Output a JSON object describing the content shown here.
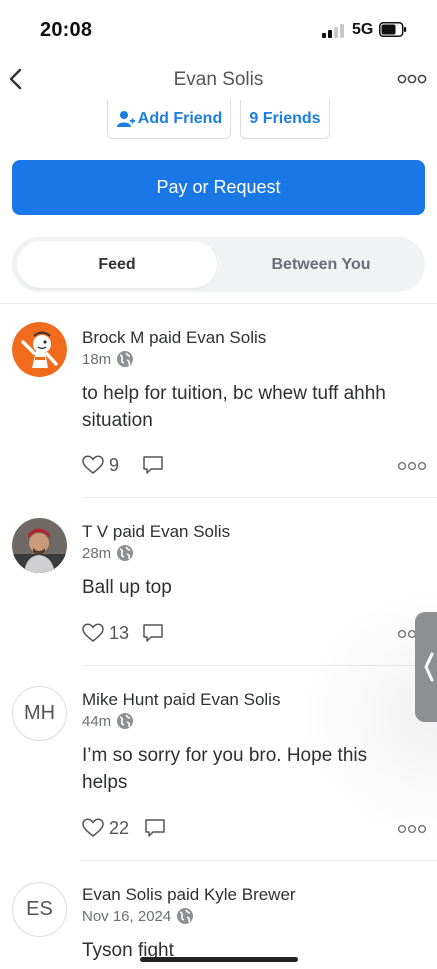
{
  "status_bar": {
    "time": "20:08",
    "network": "5G"
  },
  "header": {
    "title": "Evan Solis"
  },
  "profile_actions": {
    "add_friend": "Add Friend",
    "friends": "9 Friends"
  },
  "primary_action": {
    "label": "Pay or Request"
  },
  "tabs": [
    {
      "label": "Feed",
      "selected": true
    },
    {
      "label": "Between You",
      "selected": false
    }
  ],
  "feed": [
    {
      "sender": "Brock M",
      "verb": "paid",
      "recipient": "Evan Solis",
      "time": "18m",
      "note": "to help for tuition, bc whew tuff ahhh situation",
      "likes": "9",
      "avatar_icon": "cartoon-avatar-icon"
    },
    {
      "sender": "T V",
      "verb": "paid",
      "recipient": "Evan Solis",
      "time": "28m",
      "note": "Ball up top",
      "likes": "13",
      "avatar_icon": "photo-avatar-icon"
    },
    {
      "sender": "Mike Hunt",
      "verb": "paid",
      "recipient": "Evan Solis",
      "time": "44m",
      "note": "I’m so sorry for you bro. Hope this helps",
      "likes": "22",
      "initials": "MH"
    },
    {
      "sender": "Evan Solis",
      "verb": "paid",
      "recipient": "Kyle Brewer",
      "time": "Nov 16, 2024",
      "note": "Tyson fight",
      "initials": "ES"
    }
  ],
  "colors": {
    "accent": "#1a77e8",
    "link": "#1b7fe0",
    "text": "#2f3033",
    "muted": "#6b6e74"
  }
}
